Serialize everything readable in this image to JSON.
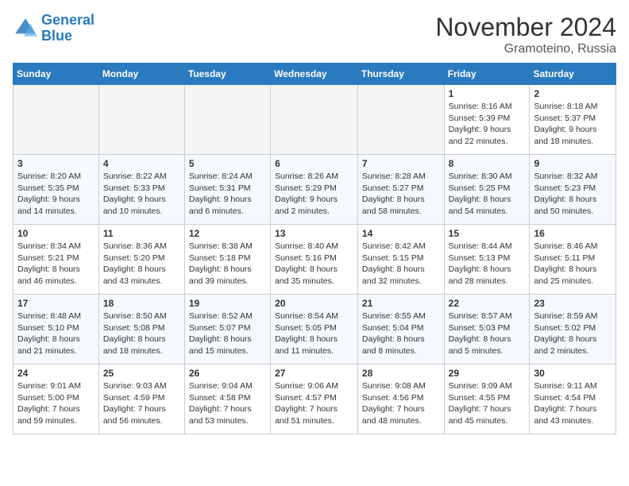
{
  "header": {
    "logo_line1": "General",
    "logo_line2": "Blue",
    "month_title": "November 2024",
    "location": "Gramoteino, Russia"
  },
  "weekdays": [
    "Sunday",
    "Monday",
    "Tuesday",
    "Wednesday",
    "Thursday",
    "Friday",
    "Saturday"
  ],
  "weeks": [
    [
      {
        "day": "",
        "info": ""
      },
      {
        "day": "",
        "info": ""
      },
      {
        "day": "",
        "info": ""
      },
      {
        "day": "",
        "info": ""
      },
      {
        "day": "",
        "info": ""
      },
      {
        "day": "1",
        "info": "Sunrise: 8:16 AM\nSunset: 5:39 PM\nDaylight: 9 hours and 22 minutes."
      },
      {
        "day": "2",
        "info": "Sunrise: 8:18 AM\nSunset: 5:37 PM\nDaylight: 9 hours and 18 minutes."
      }
    ],
    [
      {
        "day": "3",
        "info": "Sunrise: 8:20 AM\nSunset: 5:35 PM\nDaylight: 9 hours and 14 minutes."
      },
      {
        "day": "4",
        "info": "Sunrise: 8:22 AM\nSunset: 5:33 PM\nDaylight: 9 hours and 10 minutes."
      },
      {
        "day": "5",
        "info": "Sunrise: 8:24 AM\nSunset: 5:31 PM\nDaylight: 9 hours and 6 minutes."
      },
      {
        "day": "6",
        "info": "Sunrise: 8:26 AM\nSunset: 5:29 PM\nDaylight: 9 hours and 2 minutes."
      },
      {
        "day": "7",
        "info": "Sunrise: 8:28 AM\nSunset: 5:27 PM\nDaylight: 8 hours and 58 minutes."
      },
      {
        "day": "8",
        "info": "Sunrise: 8:30 AM\nSunset: 5:25 PM\nDaylight: 8 hours and 54 minutes."
      },
      {
        "day": "9",
        "info": "Sunrise: 8:32 AM\nSunset: 5:23 PM\nDaylight: 8 hours and 50 minutes."
      }
    ],
    [
      {
        "day": "10",
        "info": "Sunrise: 8:34 AM\nSunset: 5:21 PM\nDaylight: 8 hours and 46 minutes."
      },
      {
        "day": "11",
        "info": "Sunrise: 8:36 AM\nSunset: 5:20 PM\nDaylight: 8 hours and 43 minutes."
      },
      {
        "day": "12",
        "info": "Sunrise: 8:38 AM\nSunset: 5:18 PM\nDaylight: 8 hours and 39 minutes."
      },
      {
        "day": "13",
        "info": "Sunrise: 8:40 AM\nSunset: 5:16 PM\nDaylight: 8 hours and 35 minutes."
      },
      {
        "day": "14",
        "info": "Sunrise: 8:42 AM\nSunset: 5:15 PM\nDaylight: 8 hours and 32 minutes."
      },
      {
        "day": "15",
        "info": "Sunrise: 8:44 AM\nSunset: 5:13 PM\nDaylight: 8 hours and 28 minutes."
      },
      {
        "day": "16",
        "info": "Sunrise: 8:46 AM\nSunset: 5:11 PM\nDaylight: 8 hours and 25 minutes."
      }
    ],
    [
      {
        "day": "17",
        "info": "Sunrise: 8:48 AM\nSunset: 5:10 PM\nDaylight: 8 hours and 21 minutes."
      },
      {
        "day": "18",
        "info": "Sunrise: 8:50 AM\nSunset: 5:08 PM\nDaylight: 8 hours and 18 minutes."
      },
      {
        "day": "19",
        "info": "Sunrise: 8:52 AM\nSunset: 5:07 PM\nDaylight: 8 hours and 15 minutes."
      },
      {
        "day": "20",
        "info": "Sunrise: 8:54 AM\nSunset: 5:05 PM\nDaylight: 8 hours and 11 minutes."
      },
      {
        "day": "21",
        "info": "Sunrise: 8:55 AM\nSunset: 5:04 PM\nDaylight: 8 hours and 8 minutes."
      },
      {
        "day": "22",
        "info": "Sunrise: 8:57 AM\nSunset: 5:03 PM\nDaylight: 8 hours and 5 minutes."
      },
      {
        "day": "23",
        "info": "Sunrise: 8:59 AM\nSunset: 5:02 PM\nDaylight: 8 hours and 2 minutes."
      }
    ],
    [
      {
        "day": "24",
        "info": "Sunrise: 9:01 AM\nSunset: 5:00 PM\nDaylight: 7 hours and 59 minutes."
      },
      {
        "day": "25",
        "info": "Sunrise: 9:03 AM\nSunset: 4:59 PM\nDaylight: 7 hours and 56 minutes."
      },
      {
        "day": "26",
        "info": "Sunrise: 9:04 AM\nSunset: 4:58 PM\nDaylight: 7 hours and 53 minutes."
      },
      {
        "day": "27",
        "info": "Sunrise: 9:06 AM\nSunset: 4:57 PM\nDaylight: 7 hours and 51 minutes."
      },
      {
        "day": "28",
        "info": "Sunrise: 9:08 AM\nSunset: 4:56 PM\nDaylight: 7 hours and 48 minutes."
      },
      {
        "day": "29",
        "info": "Sunrise: 9:09 AM\nSunset: 4:55 PM\nDaylight: 7 hours and 45 minutes."
      },
      {
        "day": "30",
        "info": "Sunrise: 9:11 AM\nSunset: 4:54 PM\nDaylight: 7 hours and 43 minutes."
      }
    ]
  ]
}
